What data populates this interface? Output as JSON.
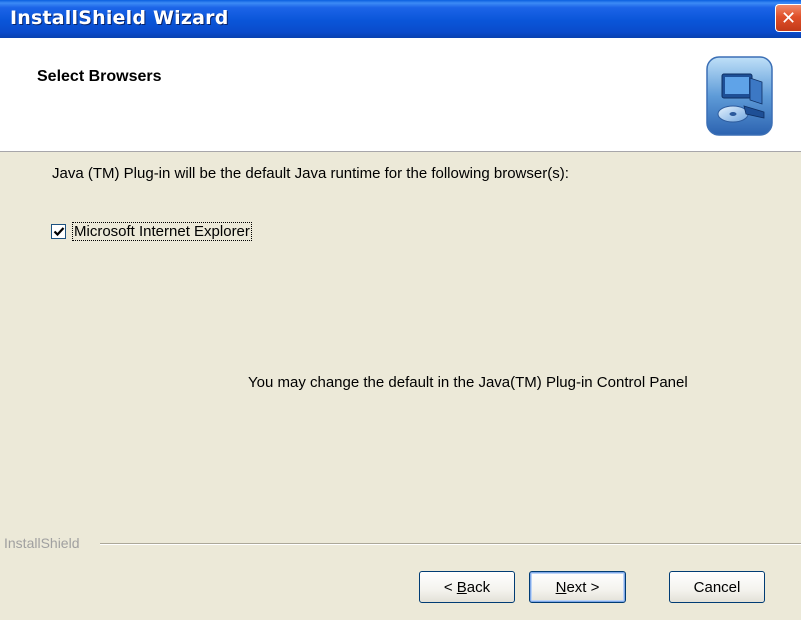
{
  "window": {
    "title": "InstallShield Wizard",
    "close_glyph": "✕"
  },
  "header": {
    "title": "Select Browsers",
    "icon": "computer-cd-icon"
  },
  "content": {
    "description": "Java (TM) Plug-in will be the default Java runtime for the following browser(s):",
    "browsers": [
      {
        "label": "Microsoft Internet Explorer",
        "checked": true
      }
    ],
    "note": "You may change the default in the Java(TM) Plug-in Control Panel"
  },
  "footer": {
    "brand": "InstallShield",
    "buttons": {
      "back_prefix": "< ",
      "back_mnemonic": "B",
      "back_rest": "ack",
      "next_mnemonic": "N",
      "next_rest": "ext >",
      "cancel": "Cancel"
    }
  },
  "colors": {
    "title_bar": "#0A55D8",
    "window_bg": "#ECE9D8",
    "close_button": "#E0502A"
  }
}
